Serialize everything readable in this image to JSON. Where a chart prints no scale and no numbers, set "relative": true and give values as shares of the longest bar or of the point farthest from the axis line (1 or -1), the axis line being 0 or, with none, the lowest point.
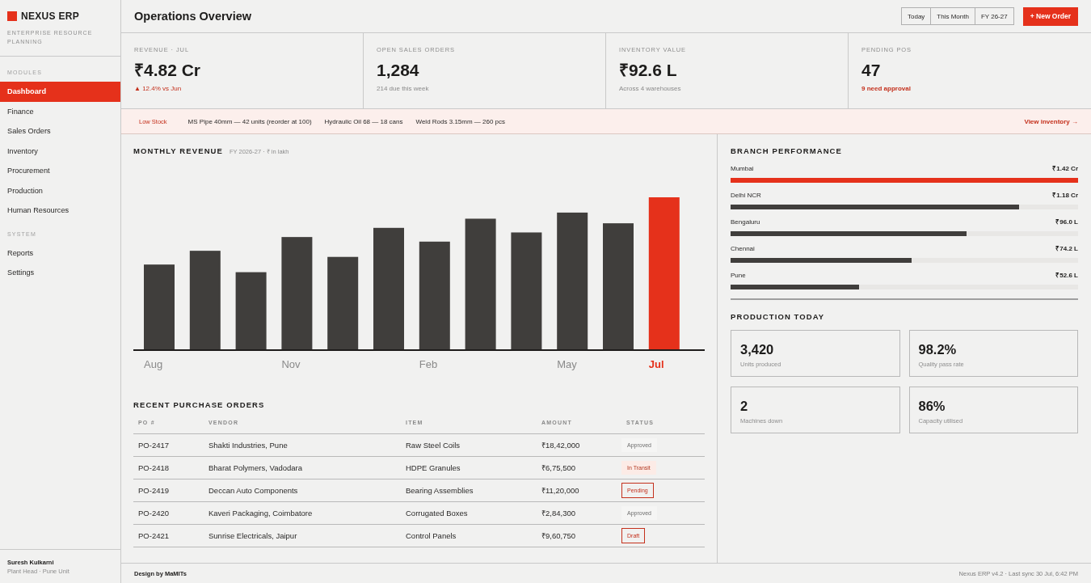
{
  "brand": {
    "name": "NEXUS ERP",
    "tagline": "ENTERPRISE RESOURCE PLANNING"
  },
  "sidebar": {
    "sections": [
      {
        "heading": "MODULES",
        "items": [
          {
            "label": "Dashboard",
            "selected": true
          },
          {
            "label": "Finance",
            "selected": false
          },
          {
            "label": "Sales Orders",
            "selected": false
          },
          {
            "label": "Inventory",
            "selected": false
          },
          {
            "label": "Procurement",
            "selected": false
          },
          {
            "label": "Production",
            "selected": false
          },
          {
            "label": "Human Resources",
            "selected": false
          }
        ]
      },
      {
        "heading": "SYSTEM",
        "items": [
          {
            "label": "Reports",
            "selected": false
          },
          {
            "label": "Settings",
            "selected": false
          }
        ]
      }
    ]
  },
  "user": {
    "name": "Suresh Kulkarni",
    "role": "Plant Head · Pune Unit"
  },
  "header": {
    "title": "Operations Overview",
    "periods": [
      {
        "label": "Today",
        "selected": false
      },
      {
        "label": "This Month",
        "selected": false
      },
      {
        "label": "FY 26-27",
        "selected": false
      }
    ],
    "action": "+ New Order"
  },
  "kpis": [
    {
      "label": "REVENUE · JUL",
      "value": "₹4.82 Cr",
      "note": {
        "text": "▲ 12.4% vs Jun",
        "kind": "trend"
      }
    },
    {
      "label": "OPEN SALES ORDERS",
      "value": "1,284",
      "note": {
        "text": "214 due this week",
        "kind": "plain"
      }
    },
    {
      "label": "INVENTORY VALUE",
      "value": "₹92.6 L",
      "note": {
        "text": "Across 4 warehouses",
        "kind": "plain"
      }
    },
    {
      "label": "PENDING POS",
      "value": "47",
      "note": {
        "text": "9 need approval",
        "kind": "alert"
      }
    }
  ],
  "alert": {
    "tag": "Low Stock",
    "items": [
      "MS Pipe 40mm — 42 units (reorder at 100)",
      "Hydraulic Oil 68 — 18 cans",
      "Weld Rods 3.15mm — 260 pcs"
    ],
    "link": "View inventory →"
  },
  "revenue": {
    "title": "MONTHLY REVENUE",
    "subtitle": "FY 2026-27 · ₹ in lakh",
    "chart_data": {
      "type": "bar",
      "relative": true,
      "stacked": true,
      "categories": [
        "Aug",
        null,
        null,
        "Nov",
        null,
        null,
        "Feb",
        null,
        null,
        "May",
        null,
        "Jul"
      ],
      "series": [
        {
          "color": "#403e3c",
          "values": [
            0.56,
            0.65,
            0.51,
            0.74,
            0.61,
            0.8,
            0.71,
            0.86,
            0.77,
            0.9,
            0.83,
            null
          ]
        },
        {
          "color": "#e5311b",
          "values": [
            null,
            null,
            null,
            null,
            null,
            null,
            null,
            null,
            null,
            null,
            null,
            1.0
          ]
        }
      ]
    }
  },
  "purchase_orders": {
    "title": "RECENT PURCHASE ORDERS",
    "columns": [
      "PO #",
      "VENDOR",
      "ITEM",
      "AMOUNT",
      "STATUS"
    ],
    "rows": [
      {
        "po": "PO-2417",
        "vendor": "Shakti Industries, Pune",
        "item": "Raw Steel Coils",
        "amount": "₹18,42,000",
        "status": {
          "label": "Approved",
          "kind": "approved"
        }
      },
      {
        "po": "PO-2418",
        "vendor": "Bharat Polymers, Vadodara",
        "item": "HDPE Granules",
        "amount": "₹6,75,500",
        "status": {
          "label": "In Transit",
          "kind": "transit"
        }
      },
      {
        "po": "PO-2419",
        "vendor": "Deccan Auto Components",
        "item": "Bearing Assemblies",
        "amount": "₹11,20,000",
        "status": {
          "label": "Pending",
          "kind": "pending"
        }
      },
      {
        "po": "PO-2420",
        "vendor": "Kaveri Packaging, Coimbatore",
        "item": "Corrugated Boxes",
        "amount": "₹2,84,300",
        "status": {
          "label": "Approved",
          "kind": "approved"
        }
      },
      {
        "po": "PO-2421",
        "vendor": "Sunrise Electricals, Jaipur",
        "item": "Control Panels",
        "amount": "₹9,60,750",
        "status": {
          "label": "Draft",
          "kind": "draft"
        }
      }
    ]
  },
  "branch_performance": {
    "title": "BRANCH PERFORMANCE",
    "branches": [
      {
        "name": "Mumbai",
        "value": "₹1.42 Cr",
        "level": 1.0,
        "color": "#e5311b"
      },
      {
        "name": "Delhi NCR",
        "value": "₹1.18 Cr",
        "level": 0.83,
        "color": "#403e3c"
      },
      {
        "name": "Bengaluru",
        "value": "₹96.0 L",
        "level": 0.68,
        "color": "#403e3c"
      },
      {
        "name": "Chennai",
        "value": "₹74.2 L",
        "level": 0.52,
        "color": "#403e3c"
      },
      {
        "name": "Pune",
        "value": "₹52.6 L",
        "level": 0.37,
        "color": "#403e3c"
      }
    ]
  },
  "production": {
    "title": "PRODUCTION TODAY",
    "stats": [
      {
        "value": "3,420",
        "label": "Units produced"
      },
      {
        "value": "98.2%",
        "label": "Quality pass rate"
      },
      {
        "value": "2",
        "label": "Machines down"
      },
      {
        "value": "86%",
        "label": "Capacity utilised"
      }
    ]
  },
  "footer": {
    "credit": "Design by MaMITs",
    "status": "Nexus ERP v4.2 · Last sync 30 Jul, 6:42 PM"
  }
}
